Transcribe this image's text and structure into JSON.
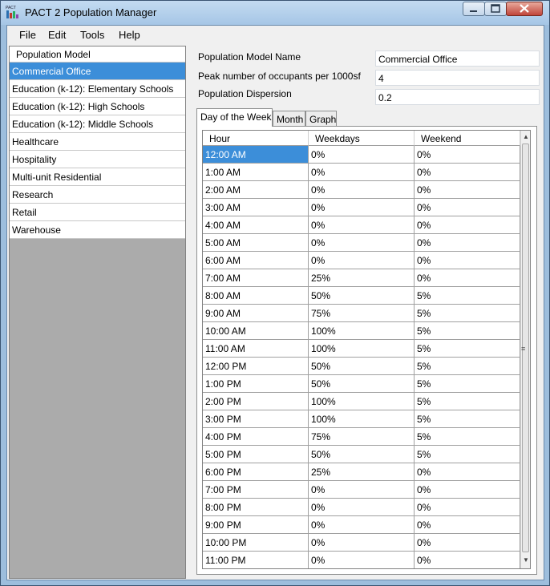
{
  "window": {
    "title": "PACT 2 Population Manager",
    "icon_text": "PACT"
  },
  "menu": [
    "File",
    "Edit",
    "Tools",
    "Help"
  ],
  "sidebar": {
    "header": "Population Model",
    "selected_index": 0,
    "items": [
      "Commercial Office",
      "Education (k-12): Elementary Schools",
      "Education (k-12): High Schools",
      "Education (k-12): Middle Schools",
      "Healthcare",
      "Hospitality",
      "Multi-unit Residential",
      "Research",
      "Retail",
      "Warehouse"
    ]
  },
  "form": {
    "name_label": "Population Model Name",
    "name_value": "Commercial Office",
    "peak_label": "Peak number of occupants per 1000sf",
    "peak_value": "4",
    "dispersion_label": "Population Dispersion",
    "dispersion_value": "0.2"
  },
  "tabs": [
    "Day of the Week",
    "Month",
    "Graph"
  ],
  "active_tab": 0,
  "grid": {
    "columns": [
      "Hour",
      "Weekdays",
      "Weekend"
    ],
    "rows": [
      [
        "12:00 AM",
        "0%",
        "0%"
      ],
      [
        "1:00 AM",
        "0%",
        "0%"
      ],
      [
        "2:00 AM",
        "0%",
        "0%"
      ],
      [
        "3:00 AM",
        "0%",
        "0%"
      ],
      [
        "4:00 AM",
        "0%",
        "0%"
      ],
      [
        "5:00 AM",
        "0%",
        "0%"
      ],
      [
        "6:00 AM",
        "0%",
        "0%"
      ],
      [
        "7:00 AM",
        "25%",
        "0%"
      ],
      [
        "8:00 AM",
        "50%",
        "5%"
      ],
      [
        "9:00 AM",
        "75%",
        "5%"
      ],
      [
        "10:00 AM",
        "100%",
        "5%"
      ],
      [
        "11:00 AM",
        "100%",
        "5%"
      ],
      [
        "12:00 PM",
        "50%",
        "5%"
      ],
      [
        "1:00 PM",
        "50%",
        "5%"
      ],
      [
        "2:00 PM",
        "100%",
        "5%"
      ],
      [
        "3:00 PM",
        "100%",
        "5%"
      ],
      [
        "4:00 PM",
        "75%",
        "5%"
      ],
      [
        "5:00 PM",
        "50%",
        "5%"
      ],
      [
        "6:00 PM",
        "25%",
        "0%"
      ],
      [
        "7:00 PM",
        "0%",
        "0%"
      ],
      [
        "8:00 PM",
        "0%",
        "0%"
      ],
      [
        "9:00 PM",
        "0%",
        "0%"
      ],
      [
        "10:00 PM",
        "0%",
        "0%"
      ],
      [
        "11:00 PM",
        "0%",
        "0%"
      ]
    ],
    "selected_cell": [
      0,
      0
    ]
  },
  "colors": {
    "selection": "#3c8ed9",
    "sidebar_background": "#ababab",
    "window_frame": "#9dbedd"
  }
}
